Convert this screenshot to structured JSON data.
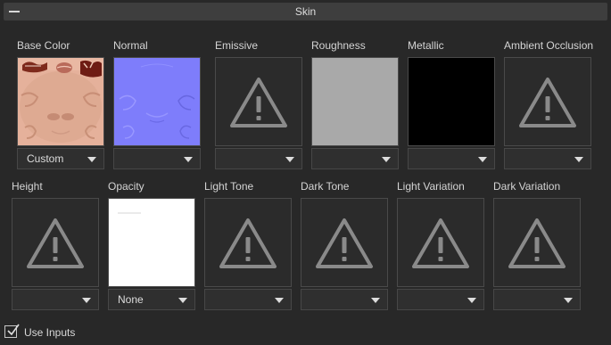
{
  "panel": {
    "title": "Skin"
  },
  "icons": {
    "collapse": "minus-icon",
    "warning": "warning-triangle-icon",
    "dropdown": "chevron-down-icon",
    "check": "checkmark-icon"
  },
  "row1": [
    {
      "label": "Base Color",
      "thumbnail": "skin-base-color-texture",
      "dropdown_value": "Custom"
    },
    {
      "label": "Normal",
      "thumbnail": "normal-map-texture",
      "dropdown_value": ""
    },
    {
      "label": "Emissive",
      "thumbnail": "warning-triangle-icon",
      "dropdown_value": ""
    },
    {
      "label": "Roughness",
      "thumbnail": "gray-texture",
      "dropdown_value": ""
    },
    {
      "label": "Metallic",
      "thumbnail": "black-texture",
      "dropdown_value": ""
    },
    {
      "label": "Ambient Occlusion",
      "thumbnail": "warning-triangle-icon",
      "dropdown_value": ""
    }
  ],
  "row2": [
    {
      "label": "Height",
      "thumbnail": "warning-triangle-icon",
      "dropdown_value": ""
    },
    {
      "label": "Opacity",
      "thumbnail": "white-texture",
      "dropdown_value": "None"
    },
    {
      "label": "Light Tone",
      "thumbnail": "warning-triangle-icon",
      "dropdown_value": ""
    },
    {
      "label": "Dark Tone",
      "thumbnail": "warning-triangle-icon",
      "dropdown_value": ""
    },
    {
      "label": "Light Variation",
      "thumbnail": "warning-triangle-icon",
      "dropdown_value": ""
    },
    {
      "label": "Dark Variation",
      "thumbnail": "warning-triangle-icon",
      "dropdown_value": ""
    }
  ],
  "footer": {
    "use_inputs_label": "Use Inputs",
    "use_inputs_checked": true
  },
  "colors": {
    "background": "#282828",
    "header": "#3e3e3e",
    "normal_map": "#7f7fff",
    "roughness": "#a9a9a9",
    "metallic": "#000000",
    "opacity": "#ffffff"
  }
}
